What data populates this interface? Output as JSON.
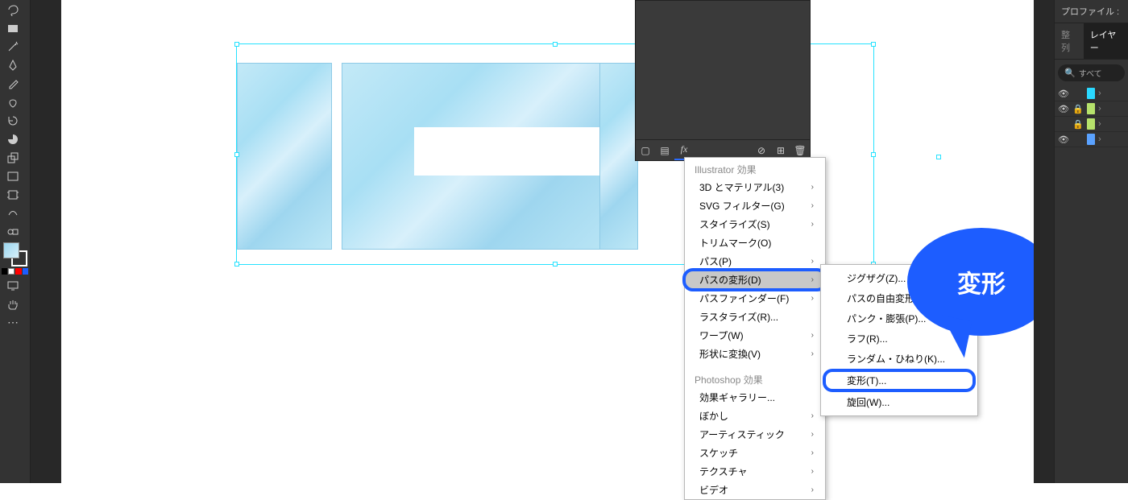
{
  "toolbox": {
    "tools": [
      "lasso",
      "rect",
      "wand",
      "pen",
      "eyedrop",
      "blob",
      "rotate",
      "pie",
      "scale",
      "rect2",
      "artboard",
      "shaper",
      "blend"
    ],
    "swatch_colors": [
      "#000",
      "#fff",
      "#f00",
      "#1d5dff"
    ]
  },
  "panel_footer_fx": "fx",
  "menu1": {
    "header": "Illustrator 効果",
    "items": [
      {
        "label": "3D とマテリアル(3)",
        "sub": true
      },
      {
        "label": "SVG フィルター(G)",
        "sub": true
      },
      {
        "label": "スタイライズ(S)",
        "sub": true
      },
      {
        "label": "トリムマーク(O)",
        "sub": false
      },
      {
        "label": "パス(P)",
        "sub": true
      },
      {
        "label": "パスの変形(D)",
        "sub": true,
        "hl": true
      },
      {
        "label": "パスファインダー(F)",
        "sub": true
      },
      {
        "label": "ラスタライズ(R)...",
        "sub": false
      },
      {
        "label": "ワープ(W)",
        "sub": true
      },
      {
        "label": "形状に変換(V)",
        "sub": true
      }
    ],
    "header2": "Photoshop 効果",
    "items2": [
      {
        "label": "効果ギャラリー...",
        "sub": false
      },
      {
        "label": "ぼかし",
        "sub": true
      },
      {
        "label": "アーティスティック",
        "sub": true
      },
      {
        "label": "スケッチ",
        "sub": true
      },
      {
        "label": "テクスチャ",
        "sub": true
      },
      {
        "label": "ビデオ",
        "sub": true
      }
    ]
  },
  "submenu": {
    "items": [
      {
        "label": "ジグザグ(Z)..."
      },
      {
        "label": "パスの自由変形..."
      },
      {
        "label": "パンク・膨張(P)..."
      },
      {
        "label": "ラフ(R)..."
      },
      {
        "label": "ランダム・ひねり(K)..."
      },
      {
        "label": "変形(T)...",
        "hl": true
      },
      {
        "label": "旋回(W)..."
      }
    ]
  },
  "bubble_text": "変形",
  "right": {
    "profile_label": "プロファイル :",
    "tabs": {
      "align": "整列",
      "layers": "レイヤー"
    },
    "search_placeholder": "すべて",
    "layers": [
      {
        "eye": true,
        "lock": false,
        "color": "#2ad8ff"
      },
      {
        "eye": true,
        "lock": true,
        "color": "#b6e26b"
      },
      {
        "eye": false,
        "lock": true,
        "color": "#b6e26b"
      },
      {
        "eye": true,
        "lock": false,
        "color": "#5aa2ff"
      }
    ]
  }
}
